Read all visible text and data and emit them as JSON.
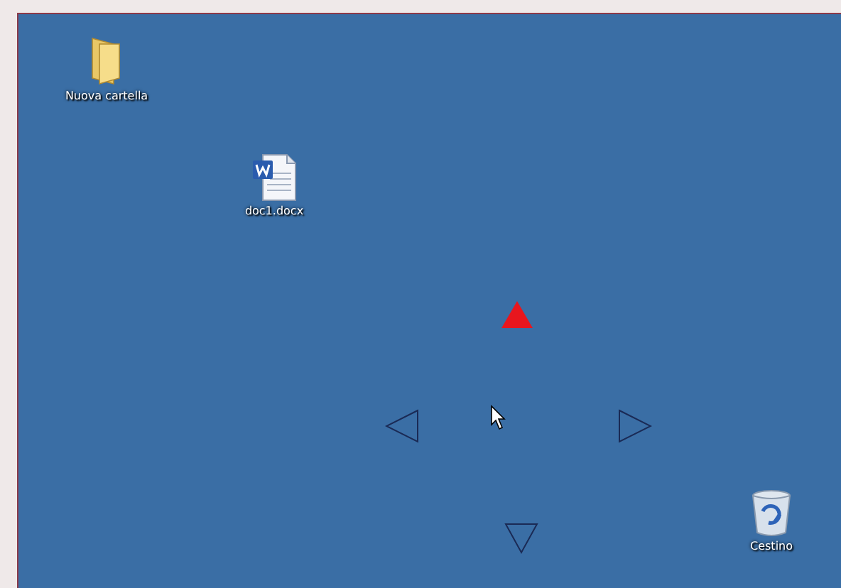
{
  "desktop": {
    "icons": [
      {
        "kind": "folder",
        "label": "Nuova cartella"
      },
      {
        "kind": "document",
        "label": "doc1.docx"
      },
      {
        "kind": "recycle-bin",
        "label": "Cestino"
      }
    ],
    "arrows": [
      {
        "kind": "up",
        "selected": true
      },
      {
        "kind": "left",
        "selected": false
      },
      {
        "kind": "right",
        "selected": false
      },
      {
        "kind": "down",
        "selected": false
      }
    ]
  }
}
